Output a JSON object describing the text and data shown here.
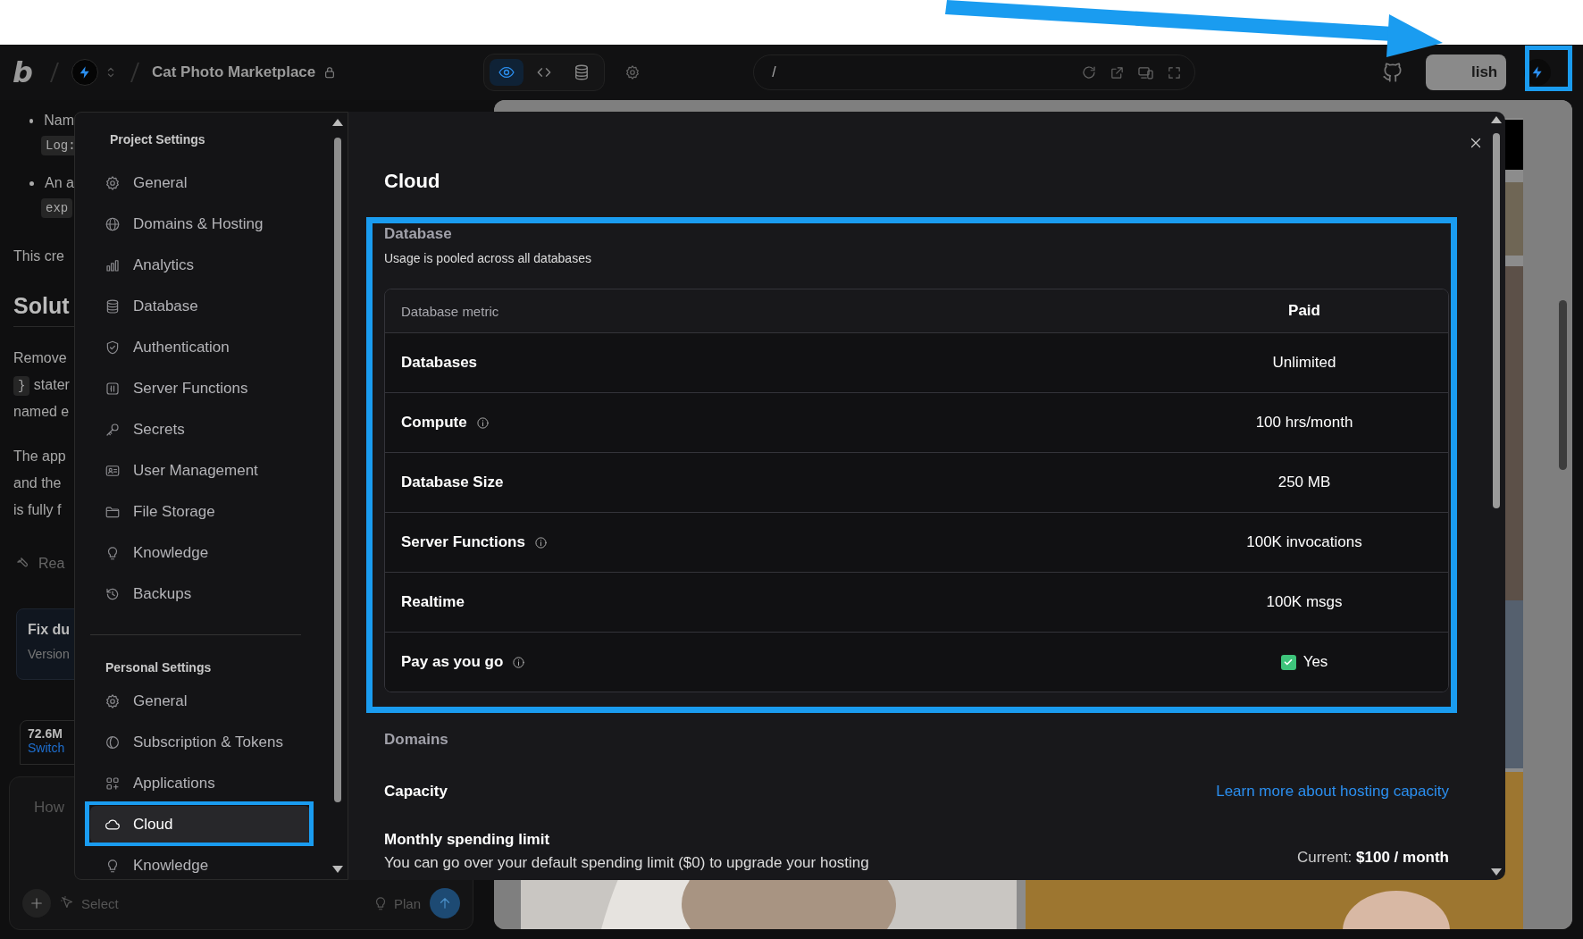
{
  "topbar": {
    "logo": "b",
    "project_title": "Cat Photo Marketplace",
    "view_modes": [
      {
        "kind": "preview",
        "selected": true
      },
      {
        "kind": "code",
        "selected": false
      },
      {
        "kind": "database",
        "selected": false
      }
    ],
    "url": "/",
    "publish_button": "lish"
  },
  "chat": {
    "blocks": [
      {
        "kind": "bullet",
        "text": "Nam",
        "code": "Log:"
      },
      {
        "kind": "bullet",
        "text": "An a",
        "code": "exp"
      },
      {
        "kind": "paragraph",
        "lines": [
          {
            "text": "This cre"
          }
        ]
      },
      {
        "kind": "heading",
        "text": "Solut"
      },
      {
        "kind": "paragraph",
        "lines": [
          {
            "text": "Remove"
          },
          {
            "code": "}",
            "text": "stater"
          },
          {
            "text": "named e"
          }
        ]
      },
      {
        "kind": "paragraph",
        "lines": [
          {
            "text": "The app"
          },
          {
            "text": "and the"
          },
          {
            "text": "is fully f"
          }
        ]
      },
      {
        "kind": "tool",
        "text": "Rea"
      }
    ],
    "version_card": {
      "title": "Fix du",
      "subtitle": "Version"
    },
    "usage_card": {
      "amount": "72.6M",
      "link": "Switch"
    },
    "input": {
      "placeholder": "How",
      "select": "Select",
      "plan": "Plan"
    }
  },
  "settings": {
    "sections": [
      {
        "title": "Project Settings",
        "items": [
          {
            "label": "General",
            "selected": false
          },
          {
            "label": "Domains & Hosting",
            "selected": false
          },
          {
            "label": "Analytics",
            "selected": false
          },
          {
            "label": "Database",
            "selected": false
          },
          {
            "label": "Authentication",
            "selected": false
          },
          {
            "label": "Server Functions",
            "selected": false
          },
          {
            "label": "Secrets",
            "selected": false
          },
          {
            "label": "User Management",
            "selected": false
          },
          {
            "label": "File Storage",
            "selected": false
          },
          {
            "label": "Knowledge",
            "selected": false
          },
          {
            "label": "Backups",
            "selected": false
          }
        ]
      },
      {
        "title": "Personal Settings",
        "items": [
          {
            "label": "General",
            "selected": false
          },
          {
            "label": "Subscription & Tokens",
            "selected": false
          },
          {
            "label": "Applications",
            "selected": false
          },
          {
            "label": "Cloud",
            "selected": true
          },
          {
            "label": "Knowledge",
            "selected": false
          }
        ]
      }
    ]
  },
  "dialog": {
    "title": "Cloud",
    "database": {
      "title": "Database",
      "subtitle": "Usage is pooled across all databases",
      "columns": [
        "Database metric",
        "Paid"
      ],
      "rows": [
        {
          "kind": "text",
          "metric": "Databases",
          "info": false,
          "value": "Unlimited"
        },
        {
          "kind": "text",
          "metric": "Compute",
          "info": true,
          "value": "100 hrs/month"
        },
        {
          "kind": "text",
          "metric": "Database Size",
          "info": false,
          "value": "250 MB"
        },
        {
          "kind": "text",
          "metric": "Server Functions",
          "info": true,
          "value": "100K invocations"
        },
        {
          "kind": "text",
          "metric": "Realtime",
          "info": false,
          "value": "100K msgs"
        },
        {
          "kind": "check",
          "metric": "Pay as you go",
          "info": true,
          "value": "Yes",
          "checked": true
        }
      ]
    },
    "domains": {
      "title": "Domains"
    },
    "capacity": {
      "title": "Capacity",
      "link": "Learn more about hosting capacity"
    },
    "spending": {
      "title": "Monthly spending limit",
      "text": "You can go over your default spending limit ($0) to upgrade your hosting",
      "current_label": "Current:",
      "current_value": "$100 / month"
    }
  }
}
